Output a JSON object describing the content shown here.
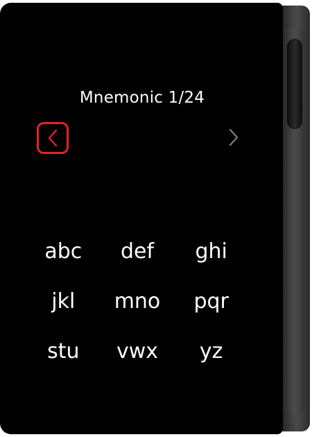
{
  "screen": {
    "title": "Mnemonic 1/24"
  },
  "navigation": {
    "prev_icon": "chevron-left-icon",
    "next_icon": "chevron-right-icon",
    "prev_color": "#e02525",
    "next_color": "#7a7a7a"
  },
  "keypad": {
    "keys": [
      "abc",
      "def",
      "ghi",
      "jkl",
      "mno",
      "pqr",
      "stu",
      "vwx",
      "yz"
    ]
  }
}
